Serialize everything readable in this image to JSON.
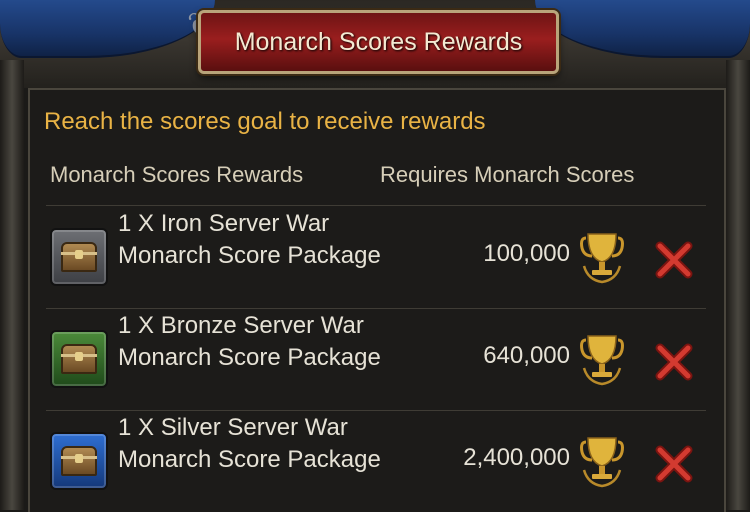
{
  "header": {
    "title": "Monarch Scores Rewards"
  },
  "instruction": "Reach the scores goal to receive rewards",
  "columns": {
    "rewards": "Monarch Scores Rewards",
    "requires": "Requires Monarch Scores"
  },
  "rows": [
    {
      "reward": "1 X Iron Server War Monarch Score Package",
      "score": "100,000",
      "chest_icon": "iron-chest-icon",
      "status": "not-reached"
    },
    {
      "reward": "1 X Bronze Server War Monarch Score Package",
      "score": "640,000",
      "chest_icon": "bronze-chest-icon",
      "status": "not-reached"
    },
    {
      "reward": "1 X Silver Server War Monarch Score Package",
      "score": "2,400,000",
      "chest_icon": "silver-chest-icon",
      "status": "not-reached"
    }
  ],
  "colors": {
    "accent": "#e9b345",
    "status_x": "#c9302c",
    "trophy_gold": "#e0b43c"
  }
}
